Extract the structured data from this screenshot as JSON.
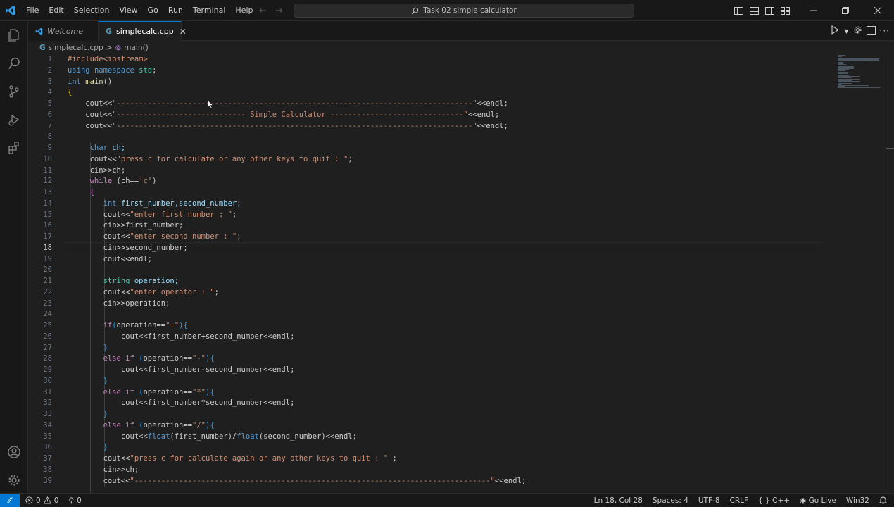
{
  "titlebar": {
    "menu": [
      "File",
      "Edit",
      "Selection",
      "View",
      "Go",
      "Run",
      "Terminal",
      "Help"
    ],
    "search_title": "Task 02 simple calculator",
    "accent": "#0078d4"
  },
  "activity_icons": [
    "files-icon",
    "search-icon",
    "source-control-icon",
    "run-debug-icon",
    "extensions-icon",
    "account-icon",
    "settings-gear-icon"
  ],
  "tabs": [
    {
      "label": "Welcome",
      "active": false
    },
    {
      "label": "simplecalc.cpp",
      "active": true
    }
  ],
  "breadcrumb": {
    "file": "simplecalc.cpp",
    "sep": ">",
    "symbol": "main()"
  },
  "editor": {
    "current_line": 18,
    "lines": [
      {
        "n": "1",
        "t": [
          [
            "#include<iostream>",
            "#ce9178"
          ]
        ]
      },
      {
        "n": "2",
        "t": [
          [
            "using ",
            "#569cd6"
          ],
          [
            "namespace ",
            "#569cd6"
          ],
          [
            "std",
            "#4ec9b0"
          ],
          [
            ";",
            "#cccccc"
          ]
        ]
      },
      {
        "n": "3",
        "t": [
          [
            "int ",
            "#569cd6"
          ],
          [
            "main",
            "#dcdcaa"
          ],
          [
            "()",
            "#cccccc"
          ]
        ]
      },
      {
        "n": "4",
        "t": [
          [
            "{",
            "#ffd700"
          ]
        ]
      },
      {
        "n": "5",
        "t": [
          [
            "    cout<<",
            "#cccccc"
          ],
          [
            "\"--------------------------------------------------------------------------------\"",
            "#ce9178"
          ],
          [
            "<<endl;",
            "#cccccc"
          ]
        ]
      },
      {
        "n": "6",
        "t": [
          [
            "    cout<<",
            "#cccccc"
          ],
          [
            "\"----------------------------- Simple Calculator ------------------------------\"",
            "#ce9178"
          ],
          [
            "<<endl;",
            "#cccccc"
          ]
        ]
      },
      {
        "n": "7",
        "t": [
          [
            "    cout<<",
            "#cccccc"
          ],
          [
            "\"--------------------------------------------------------------------------------\"",
            "#ce9178"
          ],
          [
            "<<endl;",
            "#cccccc"
          ]
        ]
      },
      {
        "n": "8",
        "t": []
      },
      {
        "n": "9",
        "t": [
          [
            "     char ",
            "#569cd6"
          ],
          [
            "ch;",
            "#9cdcfe"
          ]
        ]
      },
      {
        "n": "10",
        "t": [
          [
            "     cout<<",
            "#cccccc"
          ],
          [
            "\"press c for calculate or any other keys to quit : \"",
            "#ce9178"
          ],
          [
            ";",
            "#cccccc"
          ]
        ]
      },
      {
        "n": "11",
        "t": [
          [
            "     cin>>ch;",
            "#cccccc"
          ]
        ]
      },
      {
        "n": "12",
        "t": [
          [
            "     while ",
            "#c586c0"
          ],
          [
            "(ch==",
            "#cccccc"
          ],
          [
            "'c'",
            "#ce9178"
          ],
          [
            ")",
            "#cccccc"
          ]
        ]
      },
      {
        "n": "13",
        "t": [
          [
            "     {",
            "#da70d6"
          ]
        ]
      },
      {
        "n": "14",
        "t": [
          [
            "        int ",
            "#569cd6"
          ],
          [
            "first_number,second_number;",
            "#9cdcfe"
          ]
        ]
      },
      {
        "n": "15",
        "t": [
          [
            "        cout<<",
            "#cccccc"
          ],
          [
            "\"enter first number : \"",
            "#ce9178"
          ],
          [
            ";",
            "#cccccc"
          ]
        ]
      },
      {
        "n": "16",
        "t": [
          [
            "        cin>>first_number;",
            "#cccccc"
          ]
        ]
      },
      {
        "n": "17",
        "t": [
          [
            "        cout<<",
            "#cccccc"
          ],
          [
            "\"enter second number : \"",
            "#ce9178"
          ],
          [
            ";",
            "#cccccc"
          ]
        ]
      },
      {
        "n": "18",
        "t": [
          [
            "        cin>>second_number;",
            "#cccccc"
          ]
        ]
      },
      {
        "n": "19",
        "t": [
          [
            "        cout<<endl;",
            "#cccccc"
          ]
        ]
      },
      {
        "n": "20",
        "t": []
      },
      {
        "n": "21",
        "t": [
          [
            "        string ",
            "#4ec9b0"
          ],
          [
            "operation;",
            "#9cdcfe"
          ]
        ]
      },
      {
        "n": "22",
        "t": [
          [
            "        cout<<",
            "#cccccc"
          ],
          [
            "\"enter operator : \"",
            "#ce9178"
          ],
          [
            ";",
            "#cccccc"
          ]
        ]
      },
      {
        "n": "23",
        "t": [
          [
            "        cin>>operation;",
            "#cccccc"
          ]
        ]
      },
      {
        "n": "24",
        "t": []
      },
      {
        "n": "25",
        "t": [
          [
            "        if",
            "#c586c0"
          ],
          [
            "(",
            "#179fff"
          ],
          [
            "operation==",
            "#cccccc"
          ],
          [
            "\"+\"",
            "#ce9178"
          ],
          [
            "){",
            "#179fff"
          ]
        ]
      },
      {
        "n": "26",
        "t": [
          [
            "            cout<<first_number+second_number<<endl;",
            "#cccccc"
          ]
        ]
      },
      {
        "n": "27",
        "t": [
          [
            "        }",
            "#179fff"
          ]
        ]
      },
      {
        "n": "28",
        "t": [
          [
            "        else if ",
            "#c586c0"
          ],
          [
            "(",
            "#179fff"
          ],
          [
            "operation==",
            "#cccccc"
          ],
          [
            "\"-\"",
            "#ce9178"
          ],
          [
            "){",
            "#179fff"
          ]
        ]
      },
      {
        "n": "29",
        "t": [
          [
            "            cout<<first_number-second_number<<endl;",
            "#cccccc"
          ]
        ]
      },
      {
        "n": "30",
        "t": [
          [
            "        }",
            "#179fff"
          ]
        ]
      },
      {
        "n": "31",
        "t": [
          [
            "        else if ",
            "#c586c0"
          ],
          [
            "(",
            "#179fff"
          ],
          [
            "operation==",
            "#cccccc"
          ],
          [
            "\"*\"",
            "#ce9178"
          ],
          [
            "){",
            "#179fff"
          ]
        ]
      },
      {
        "n": "32",
        "t": [
          [
            "            cout<<first_number*second_number<<endl;",
            "#cccccc"
          ]
        ]
      },
      {
        "n": "33",
        "t": [
          [
            "        }",
            "#179fff"
          ]
        ]
      },
      {
        "n": "34",
        "t": [
          [
            "        else if ",
            "#c586c0"
          ],
          [
            "(",
            "#179fff"
          ],
          [
            "operation==",
            "#cccccc"
          ],
          [
            "\"/\"",
            "#ce9178"
          ],
          [
            "){",
            "#179fff"
          ]
        ]
      },
      {
        "n": "35",
        "t": [
          [
            "            cout<<",
            "#cccccc"
          ],
          [
            "float",
            "#569cd6"
          ],
          [
            "(first_number)/",
            "#cccccc"
          ],
          [
            "float",
            "#569cd6"
          ],
          [
            "(second_number)<<endl;",
            "#cccccc"
          ]
        ]
      },
      {
        "n": "36",
        "t": [
          [
            "        }",
            "#179fff"
          ]
        ]
      },
      {
        "n": "37",
        "t": [
          [
            "        cout<<",
            "#cccccc"
          ],
          [
            "\"press c for calculate again or any other keys to quit : \"",
            "#ce9178"
          ],
          [
            " ;",
            "#cccccc"
          ]
        ]
      },
      {
        "n": "38",
        "t": [
          [
            "        cin>>ch;",
            "#cccccc"
          ]
        ]
      },
      {
        "n": "39",
        "t": [
          [
            "        cout<<",
            "#cccccc"
          ],
          [
            "\"--------------------------------------------------------------------------------\"",
            "#ce9178"
          ],
          [
            "<<endl;",
            "#cccccc"
          ]
        ]
      }
    ]
  },
  "statusbar": {
    "errors": "0",
    "warnings": "0",
    "ports": "0",
    "position": "Ln 18, Col 28",
    "spaces": "Spaces: 4",
    "encoding": "UTF-8",
    "eol": "CRLF",
    "language": "C++",
    "golive": "Go Live",
    "platform": "Win32"
  }
}
